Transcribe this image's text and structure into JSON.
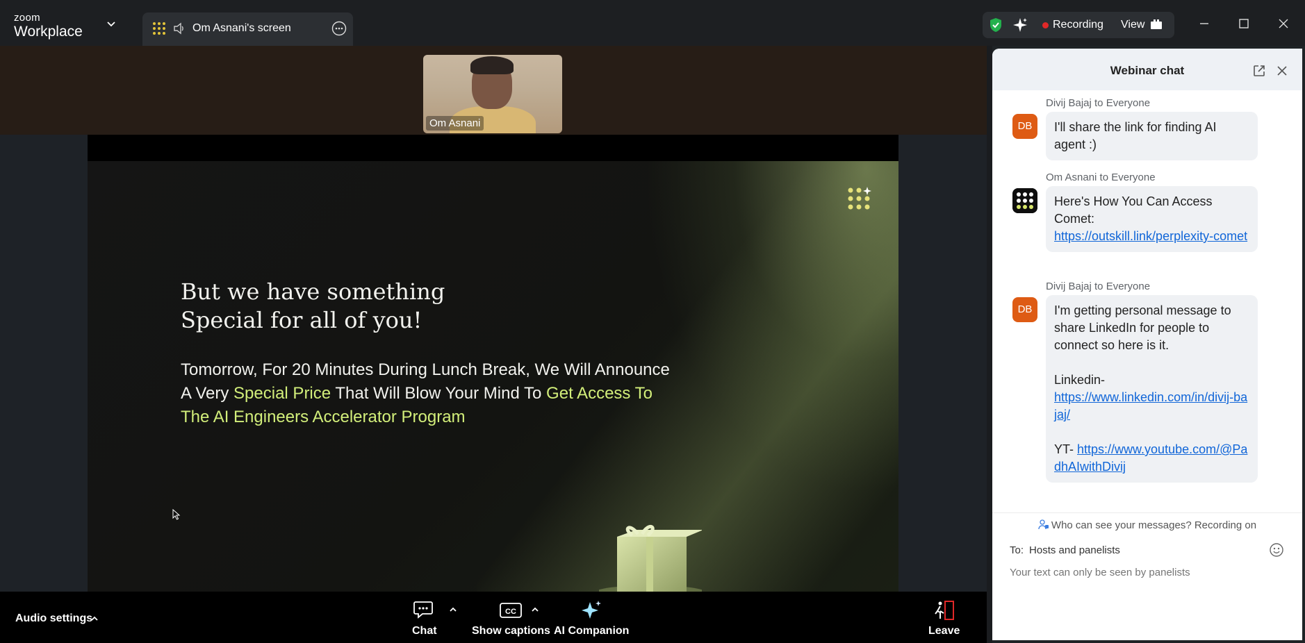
{
  "titlebar": {
    "brand_top": "zoom",
    "brand_bottom": "Workplace",
    "screen_tab_label": "Om Asnani's screen",
    "recording_label": "Recording",
    "view_label": "View",
    "icons": [
      "chevron-down-icon",
      "apps-grid-icon",
      "speaker-icon",
      "more-icon",
      "shield-check-icon",
      "ai-sparkle-icon",
      "view-grid-icon",
      "minimize-icon",
      "maximize-icon",
      "close-icon"
    ]
  },
  "participant": {
    "name": "Om Asnani"
  },
  "slide": {
    "title_line1": "But we have something",
    "title_line2": "Special for all of you!",
    "body_part1": "Tomorrow, For 20 Minutes During Lunch Break, We Will Announce A Very ",
    "body_highlight1": "Special Price",
    "body_part2": " That Will Blow Your Mind To ",
    "body_highlight2": "Get Access To The AI Engineers Accelerator Program",
    "accent_color": "#d2ee7a"
  },
  "toolbar": {
    "audio_settings": "Audio settings",
    "chat": "Chat",
    "captions": "Show captions",
    "ai_companion": "AI Companion",
    "leave": "Leave"
  },
  "chat": {
    "title": "Webinar chat",
    "messages": [
      {
        "sender": "Divij Bajaj to Everyone",
        "initials": "DB",
        "text": "I'll share the link for finding AI agent :)"
      },
      {
        "sender": "Om Asnani to Everyone",
        "text": "Here's How You Can Access Comet:",
        "link": "https://outskill.link/perplexity-comet"
      },
      {
        "sender": "Divij Bajaj to Everyone",
        "initials": "DB",
        "text": "I'm getting personal message to share LinkedIn for people to connect so here is it.",
        "linkedin_label": "Linkedin-",
        "linkedin_link": "https://www.linkedin.com/in/divij-bajaj/",
        "yt_label": "YT- ",
        "yt_link": "https://www.youtube.com/@PadhAIwithDivij"
      }
    ],
    "privacy_notice": "Who can see your messages? Recording on",
    "to_label": "To:",
    "to_value": "Hosts and panelists",
    "input_placeholder": "Your text can only be seen by panelists",
    "avatar_color": "#de5b14",
    "link_color": "#1166d8"
  }
}
